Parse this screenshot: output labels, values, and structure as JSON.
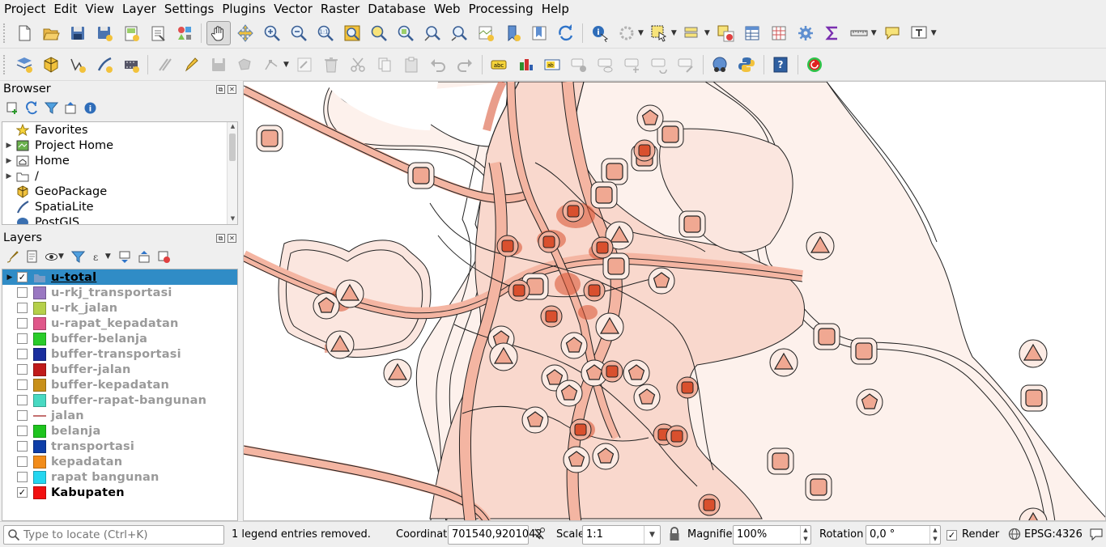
{
  "menu": [
    "Project",
    "Edit",
    "View",
    "Layer",
    "Settings",
    "Plugins",
    "Vector",
    "Raster",
    "Database",
    "Web",
    "Processing",
    "Help"
  ],
  "browser": {
    "title": "Browser",
    "items": [
      {
        "label": "Favorites",
        "icon": "star-icon",
        "expand": false
      },
      {
        "label": "Project Home",
        "icon": "project-home-icon",
        "expand": true
      },
      {
        "label": "Home",
        "icon": "home-folder-icon",
        "expand": true
      },
      {
        "label": "/",
        "icon": "folder-icon",
        "expand": true
      },
      {
        "label": "GeoPackage",
        "icon": "geopackage-icon",
        "expand": false
      },
      {
        "label": "SpatiaLite",
        "icon": "spatialite-icon",
        "expand": false
      },
      {
        "label": "PostGIS",
        "icon": "postgis-icon",
        "expand": false
      }
    ]
  },
  "layers": {
    "title": "Layers",
    "items": [
      {
        "name": "u-total",
        "checked": true,
        "color": "#7a9cc6",
        "kind": "raster",
        "selected": true,
        "expand": true
      },
      {
        "name": "u-rkj_transportasi",
        "checked": false,
        "color": "#9a78c2",
        "kind": "fill"
      },
      {
        "name": "u-rk_jalan",
        "checked": false,
        "color": "#b5d04a",
        "kind": "fill"
      },
      {
        "name": "u-rapat_kepadatan",
        "checked": false,
        "color": "#e0578a",
        "kind": "fill"
      },
      {
        "name": "buffer-belanja",
        "checked": false,
        "color": "#29cc29",
        "kind": "fill"
      },
      {
        "name": "buffer-transportasi",
        "checked": false,
        "color": "#1a2e9e",
        "kind": "fill"
      },
      {
        "name": "buffer-jalan",
        "checked": false,
        "color": "#c01b1b",
        "kind": "fill"
      },
      {
        "name": "buffer-kepadatan",
        "checked": false,
        "color": "#c8901a",
        "kind": "fill"
      },
      {
        "name": "buffer-rapat-bangunan",
        "checked": false,
        "color": "#48d9c2",
        "kind": "fill"
      },
      {
        "name": "jalan",
        "checked": false,
        "color": "#c47070",
        "kind": "line"
      },
      {
        "name": "belanja",
        "checked": false,
        "color": "#1ec41e",
        "kind": "fill"
      },
      {
        "name": "transportasi",
        "checked": false,
        "color": "#0e3ea8",
        "kind": "fill"
      },
      {
        "name": "kepadatan",
        "checked": false,
        "color": "#f28c1a",
        "kind": "fill"
      },
      {
        "name": "rapat bangunan",
        "checked": false,
        "color": "#24d6f0",
        "kind": "fill"
      },
      {
        "name": "Kabupaten",
        "checked": true,
        "color": "#f21010",
        "kind": "fill"
      }
    ]
  },
  "status": {
    "locate_placeholder": "Type to locate (Ctrl+K)",
    "message": "1 legend entries removed.",
    "coordinate_label": "Coordinate",
    "coordinate": "701540,9201042",
    "scale_label": "Scale",
    "scale": "1:1",
    "magnifier_label": "Magnifier",
    "magnifier": "100%",
    "rotation_label": "Rotation",
    "rotation": "0,0 °",
    "render_label": "Render",
    "render_checked": true,
    "crs": "EPSG:4326"
  }
}
